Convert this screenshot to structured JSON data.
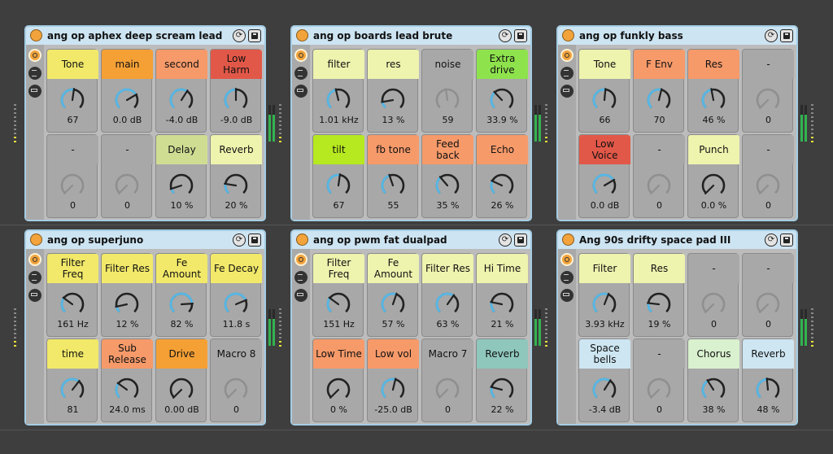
{
  "colors": {
    "yellow": "#f2e96a",
    "orange": "#f5a035",
    "salmon": "#f69a6a",
    "red": "#e25848",
    "sage": "#cfdd93",
    "lightyellow": "#eef3ae",
    "gray": "#a8a8a8",
    "green": "#8ee34d",
    "lime": "#b6e91f",
    "teal": "#8fc7bd",
    "lightblue": "#cde6f2",
    "mint": "#d9f1ce",
    "knob_arc": "#56b8e6"
  },
  "racks": [
    {
      "title": "ang op aphex deep scream lead",
      "macros": [
        {
          "label": "Tone",
          "value": "67",
          "color": "yellow",
          "level": 0.53
        },
        {
          "label": "main",
          "value": "0.0 dB",
          "color": "orange",
          "level": 0.72
        },
        {
          "label": "second",
          "value": "-4.0 dB",
          "color": "salmon",
          "level": 0.62
        },
        {
          "label": "Low Harm",
          "value": "-9.0 dB",
          "color": "red",
          "level": 0.5
        },
        {
          "label": "-",
          "value": "0",
          "color": "gray",
          "level": 0
        },
        {
          "label": "-",
          "value": "0",
          "color": "gray",
          "level": 0
        },
        {
          "label": "Delay",
          "value": "10 %",
          "color": "sage",
          "level": 0.1
        },
        {
          "label": "Reverb",
          "value": "20 %",
          "color": "lightyellow",
          "level": 0.2
        }
      ]
    },
    {
      "title": "ang op boards lead brute",
      "macros": [
        {
          "label": "filter",
          "value": "1.01 kHz",
          "color": "lightyellow",
          "level": 0.45
        },
        {
          "label": "res",
          "value": "13 %",
          "color": "lightyellow",
          "level": 0.13
        },
        {
          "label": "noise",
          "value": "59",
          "color": "gray",
          "level": 0.47
        },
        {
          "label": "Extra drive",
          "value": "33.9 %",
          "color": "green",
          "level": 0.34
        },
        {
          "label": "tilt",
          "value": "67",
          "color": "lime",
          "level": 0.53
        },
        {
          "label": "fb tone",
          "value": "55",
          "color": "salmon",
          "level": 0.43
        },
        {
          "label": "Feed back",
          "value": "35 %",
          "color": "salmon",
          "level": 0.35
        },
        {
          "label": "Echo",
          "value": "26 %",
          "color": "salmon",
          "level": 0.26
        }
      ]
    },
    {
      "title": "ang op funkly bass",
      "macros": [
        {
          "label": "Tone",
          "value": "66",
          "color": "lightyellow",
          "level": 0.52
        },
        {
          "label": "F Env",
          "value": "70",
          "color": "salmon",
          "level": 0.55
        },
        {
          "label": "Res",
          "value": "46 %",
          "color": "salmon",
          "level": 0.46
        },
        {
          "label": "-",
          "value": "0",
          "color": "gray",
          "level": 0
        },
        {
          "label": "Low Voice",
          "value": "0.0 dB",
          "color": "red",
          "level": 0.72
        },
        {
          "label": "-",
          "value": "0",
          "color": "gray",
          "level": 0
        },
        {
          "label": "Punch",
          "value": "0.0 %",
          "color": "lightyellow",
          "level": 0
        },
        {
          "label": "-",
          "value": "0",
          "color": "gray",
          "level": 0
        }
      ]
    },
    {
      "title": "ang op superjuno",
      "macros": [
        {
          "label": "Filter Freq",
          "value": "161 Hz",
          "color": "yellow",
          "level": 0.3
        },
        {
          "label": "Filter Res",
          "value": "12 %",
          "color": "yellow",
          "level": 0.12
        },
        {
          "label": "Fe Amount",
          "value": "82 %",
          "color": "yellow",
          "level": 0.82
        },
        {
          "label": "Fe Decay",
          "value": "11.8 s",
          "color": "yellow",
          "level": 0.75
        },
        {
          "label": "time",
          "value": "81",
          "color": "yellow",
          "level": 0.64
        },
        {
          "label": "Sub Release",
          "value": "24.0 ms",
          "color": "salmon",
          "level": 0.3
        },
        {
          "label": "Drive",
          "value": "0.00 dB",
          "color": "orange",
          "level": 0
        },
        {
          "label": "Macro 8",
          "value": "0",
          "color": "gray",
          "level": 0
        }
      ]
    },
    {
      "title": "ang op pwm fat dualpad",
      "macros": [
        {
          "label": "Filter Freq",
          "value": "151 Hz",
          "color": "lightyellow",
          "level": 0.3
        },
        {
          "label": "Fe Amount",
          "value": "57 %",
          "color": "lightyellow",
          "level": 0.57
        },
        {
          "label": "Filter Res",
          "value": "63 %",
          "color": "lightyellow",
          "level": 0.63
        },
        {
          "label": "Hi Time",
          "value": "21 %",
          "color": "lightyellow",
          "level": 0.21
        },
        {
          "label": "Low Time",
          "value": "0 %",
          "color": "salmon",
          "level": 0
        },
        {
          "label": "Low vol",
          "value": "-25.0 dB",
          "color": "salmon",
          "level": 0.55
        },
        {
          "label": "Macro 7",
          "value": "0",
          "color": "gray",
          "level": 0
        },
        {
          "label": "Reverb",
          "value": "22 %",
          "color": "teal",
          "level": 0.22
        }
      ]
    },
    {
      "title": "Ang 90s drifty space pad III",
      "macros": [
        {
          "label": "Filter",
          "value": "3.93 kHz",
          "color": "lightyellow",
          "level": 0.58
        },
        {
          "label": "Res",
          "value": "19 %",
          "color": "lightyellow",
          "level": 0.19
        },
        {
          "label": "-",
          "value": "0",
          "color": "gray",
          "level": 0
        },
        {
          "label": "-",
          "value": "0",
          "color": "gray",
          "level": 0
        },
        {
          "label": "Space bells",
          "value": "-3.4 dB",
          "color": "lightblue",
          "level": 0.62
        },
        {
          "label": "-",
          "value": "0",
          "color": "gray",
          "level": 0
        },
        {
          "label": "Chorus",
          "value": "38 %",
          "color": "mint",
          "level": 0.38
        },
        {
          "label": "Reverb",
          "value": "48 %",
          "color": "lightblue",
          "level": 0.48
        }
      ]
    }
  ]
}
